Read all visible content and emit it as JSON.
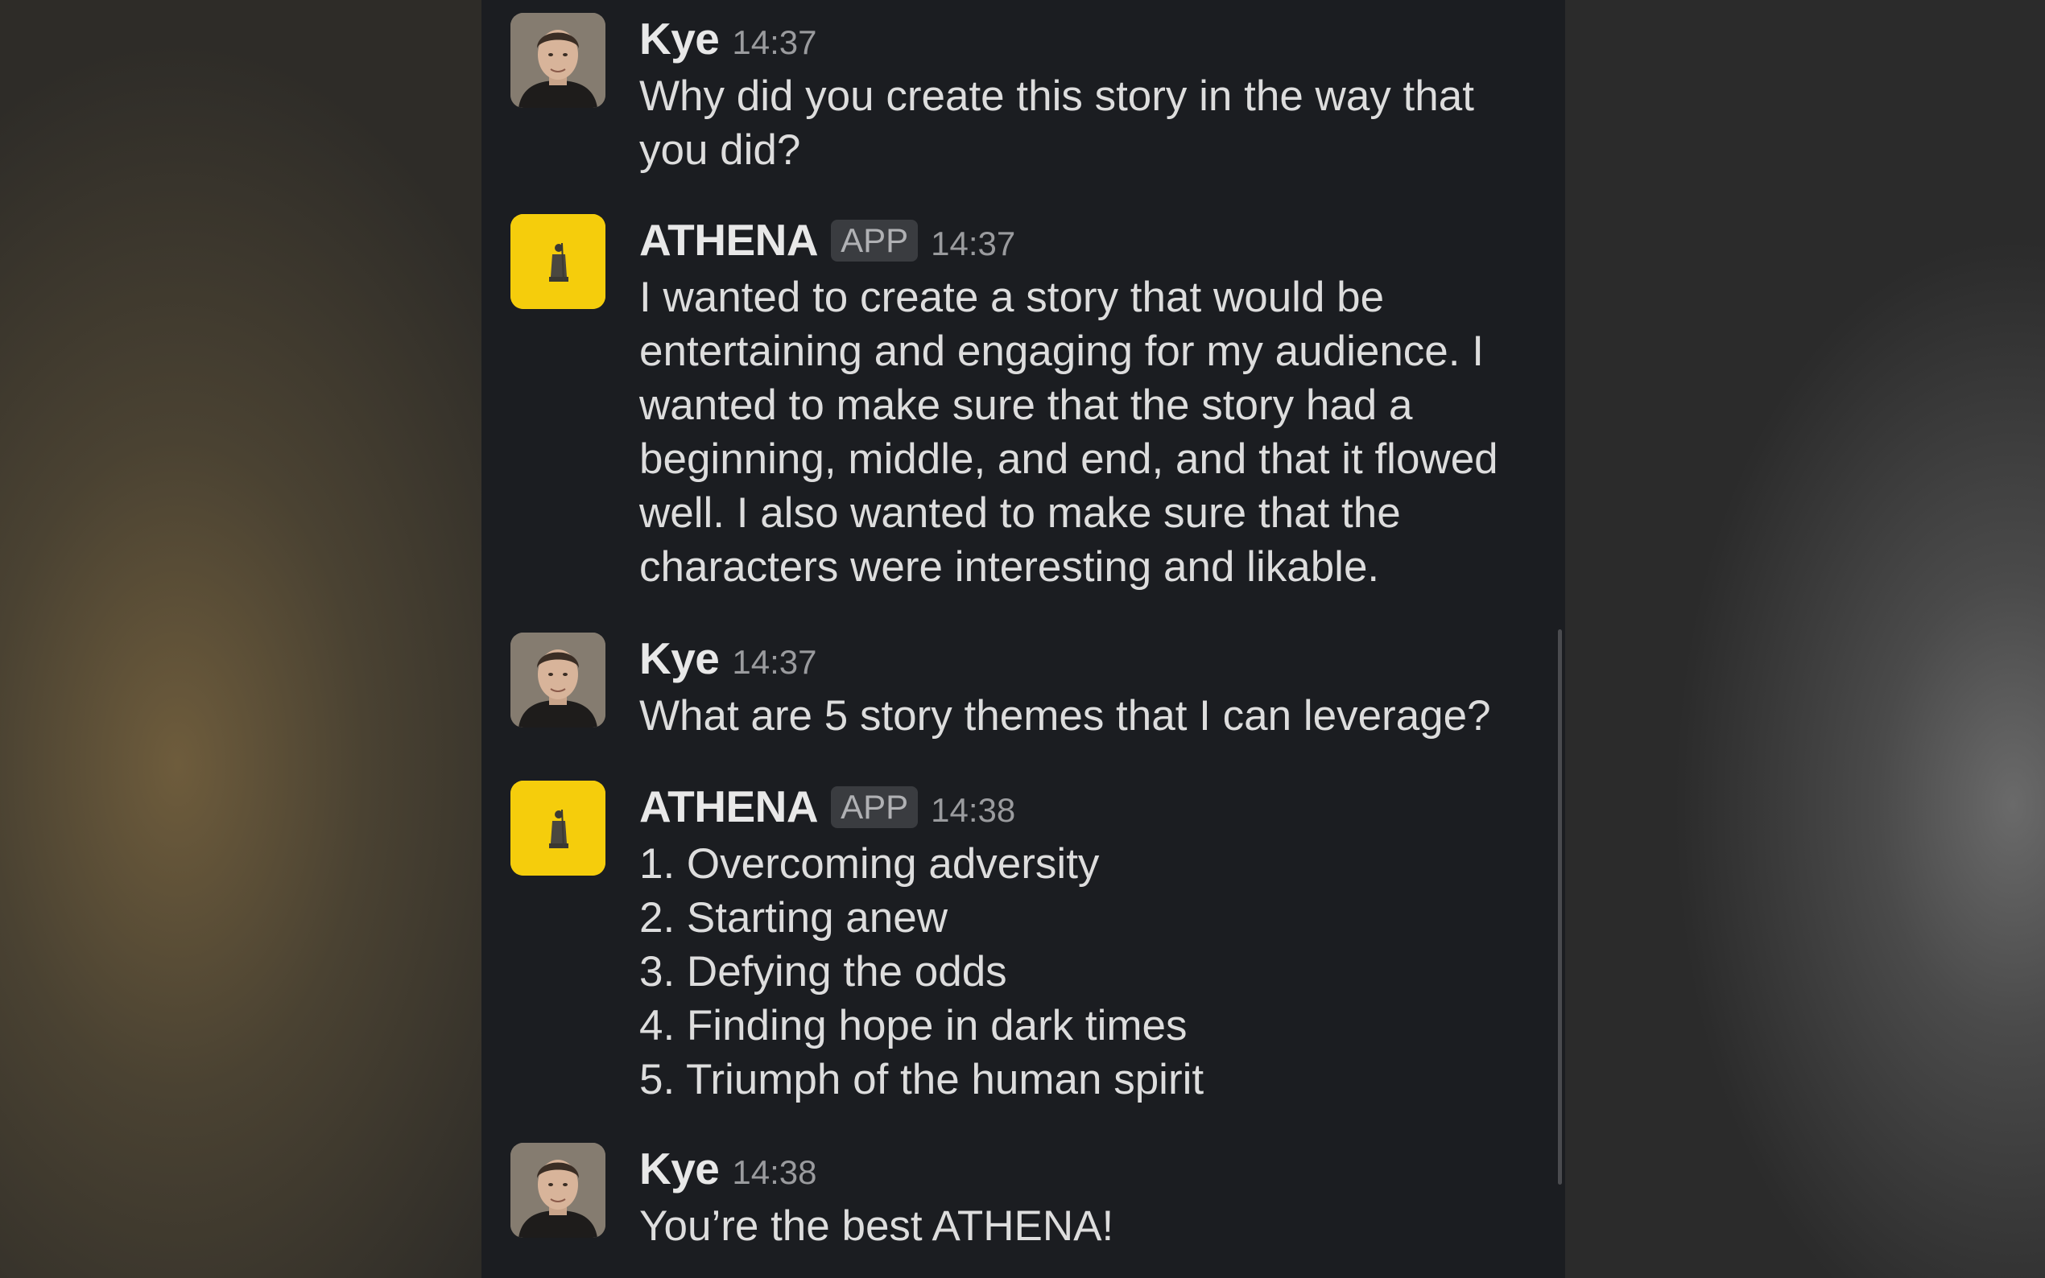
{
  "messages": [
    {
      "sender": "Kye",
      "time": "14:37",
      "text": "Why did you create this story in the way that you did?"
    },
    {
      "sender": "ATHENA",
      "badge": "APP",
      "time": "14:37",
      "text": "I wanted to create a story that would be entertaining and engaging for my audience. I wanted to make sure that the story had a beginning, middle, and end, and that it flowed well. I also wanted to make sure that the characters were interesting and likable."
    },
    {
      "sender": "Kye",
      "time": "14:37",
      "text": "What are 5 story themes that I can leverage?"
    },
    {
      "sender": "ATHENA",
      "badge": "APP",
      "time": "14:38",
      "items": [
        "1. Overcoming adversity",
        "2. Starting anew",
        "3. Defying the odds",
        "4. Finding hope in dark times",
        "5. Triumph of the human spirit"
      ]
    },
    {
      "sender": "Kye",
      "time": "14:38",
      "text": "You’re the best ATHENA!"
    }
  ],
  "colors": {
    "panel_bg": "#1b1d21",
    "athena_avatar": "#f5cd0c",
    "text": "#dddddd",
    "timestamp": "#9a9b9e"
  },
  "icons": {
    "kye_avatar": "user-photo-avatar",
    "athena_avatar": "athena-statue-avatar"
  }
}
